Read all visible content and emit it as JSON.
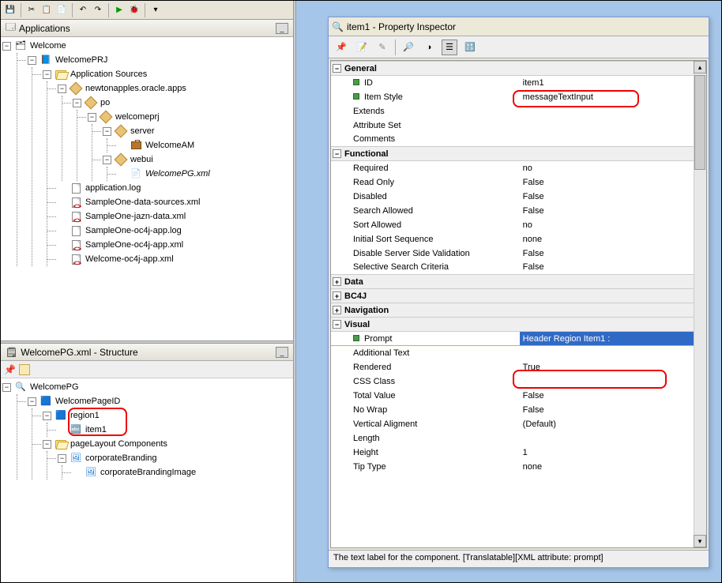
{
  "applications_panel": {
    "title": "Applications"
  },
  "tree": {
    "root": "Welcome",
    "project": "WelcomePRJ",
    "app_sources": "Application Sources",
    "pkg1": "newtonapples.oracle.apps",
    "pkg_po": "po",
    "pkg_welcomeprj": "welcomeprj",
    "pkg_server": "server",
    "welcome_am": "WelcomeAM",
    "pkg_webui": "webui",
    "welcome_pg": "WelcomePG.xml",
    "files": [
      "application.log",
      "SampleOne-data-sources.xml",
      "SampleOne-jazn-data.xml",
      "SampleOne-oc4j-app.log",
      "SampleOne-oc4j-app.xml",
      "Welcome-oc4j-app.xml"
    ]
  },
  "structure_panel": {
    "title": "WelcomePG.xml - Structure",
    "root": "WelcomePG",
    "page_id": "WelcomePageID",
    "region1": "region1",
    "item1": "item1",
    "page_layout": "pageLayout Components",
    "corp_brand": "corporateBranding",
    "corp_brand_img": "corporateBrandingImage"
  },
  "inspector": {
    "title": "item1 - Property Inspector",
    "hint": "The text label for the component. [Translatable][XML attribute: prompt]",
    "categories": {
      "general": "General",
      "functional": "Functional",
      "data": "Data",
      "bc4j": "BC4J",
      "navigation": "Navigation",
      "visual": "Visual"
    },
    "general": {
      "id_k": "ID",
      "id_v": "item1",
      "style_k": "Item Style",
      "style_v": "messageTextInput",
      "extends_k": "Extends",
      "extends_v": "",
      "attrset_k": "Attribute Set",
      "attrset_v": "",
      "comments_k": "Comments",
      "comments_v": ""
    },
    "functional": {
      "required_k": "Required",
      "required_v": "no",
      "readonly_k": "Read Only",
      "readonly_v": "False",
      "disabled_k": "Disabled",
      "disabled_v": "False",
      "search_k": "Search Allowed",
      "search_v": "False",
      "sort_k": "Sort Allowed",
      "sort_v": "no",
      "initsort_k": "Initial Sort Sequence",
      "initsort_v": "none",
      "dsv_k": "Disable Server Side Validation",
      "dsv_v": "False",
      "ssc_k": "Selective Search Criteria",
      "ssc_v": "False"
    },
    "visual": {
      "prompt_k": "Prompt",
      "prompt_v": "Header Region Item1  :",
      "addtext_k": "Additional Text",
      "addtext_v": "",
      "rendered_k": "Rendered",
      "rendered_v": "True",
      "css_k": "CSS Class",
      "css_v": "",
      "total_k": "Total Value",
      "total_v": "False",
      "nowrap_k": "No Wrap",
      "nowrap_v": "False",
      "valign_k": "Vertical Aligment",
      "valign_v": "(Default)",
      "length_k": "Length",
      "length_v": "",
      "height_k": "Height",
      "height_v": "1",
      "tip_k": "Tip Type",
      "tip_v": "none"
    }
  }
}
